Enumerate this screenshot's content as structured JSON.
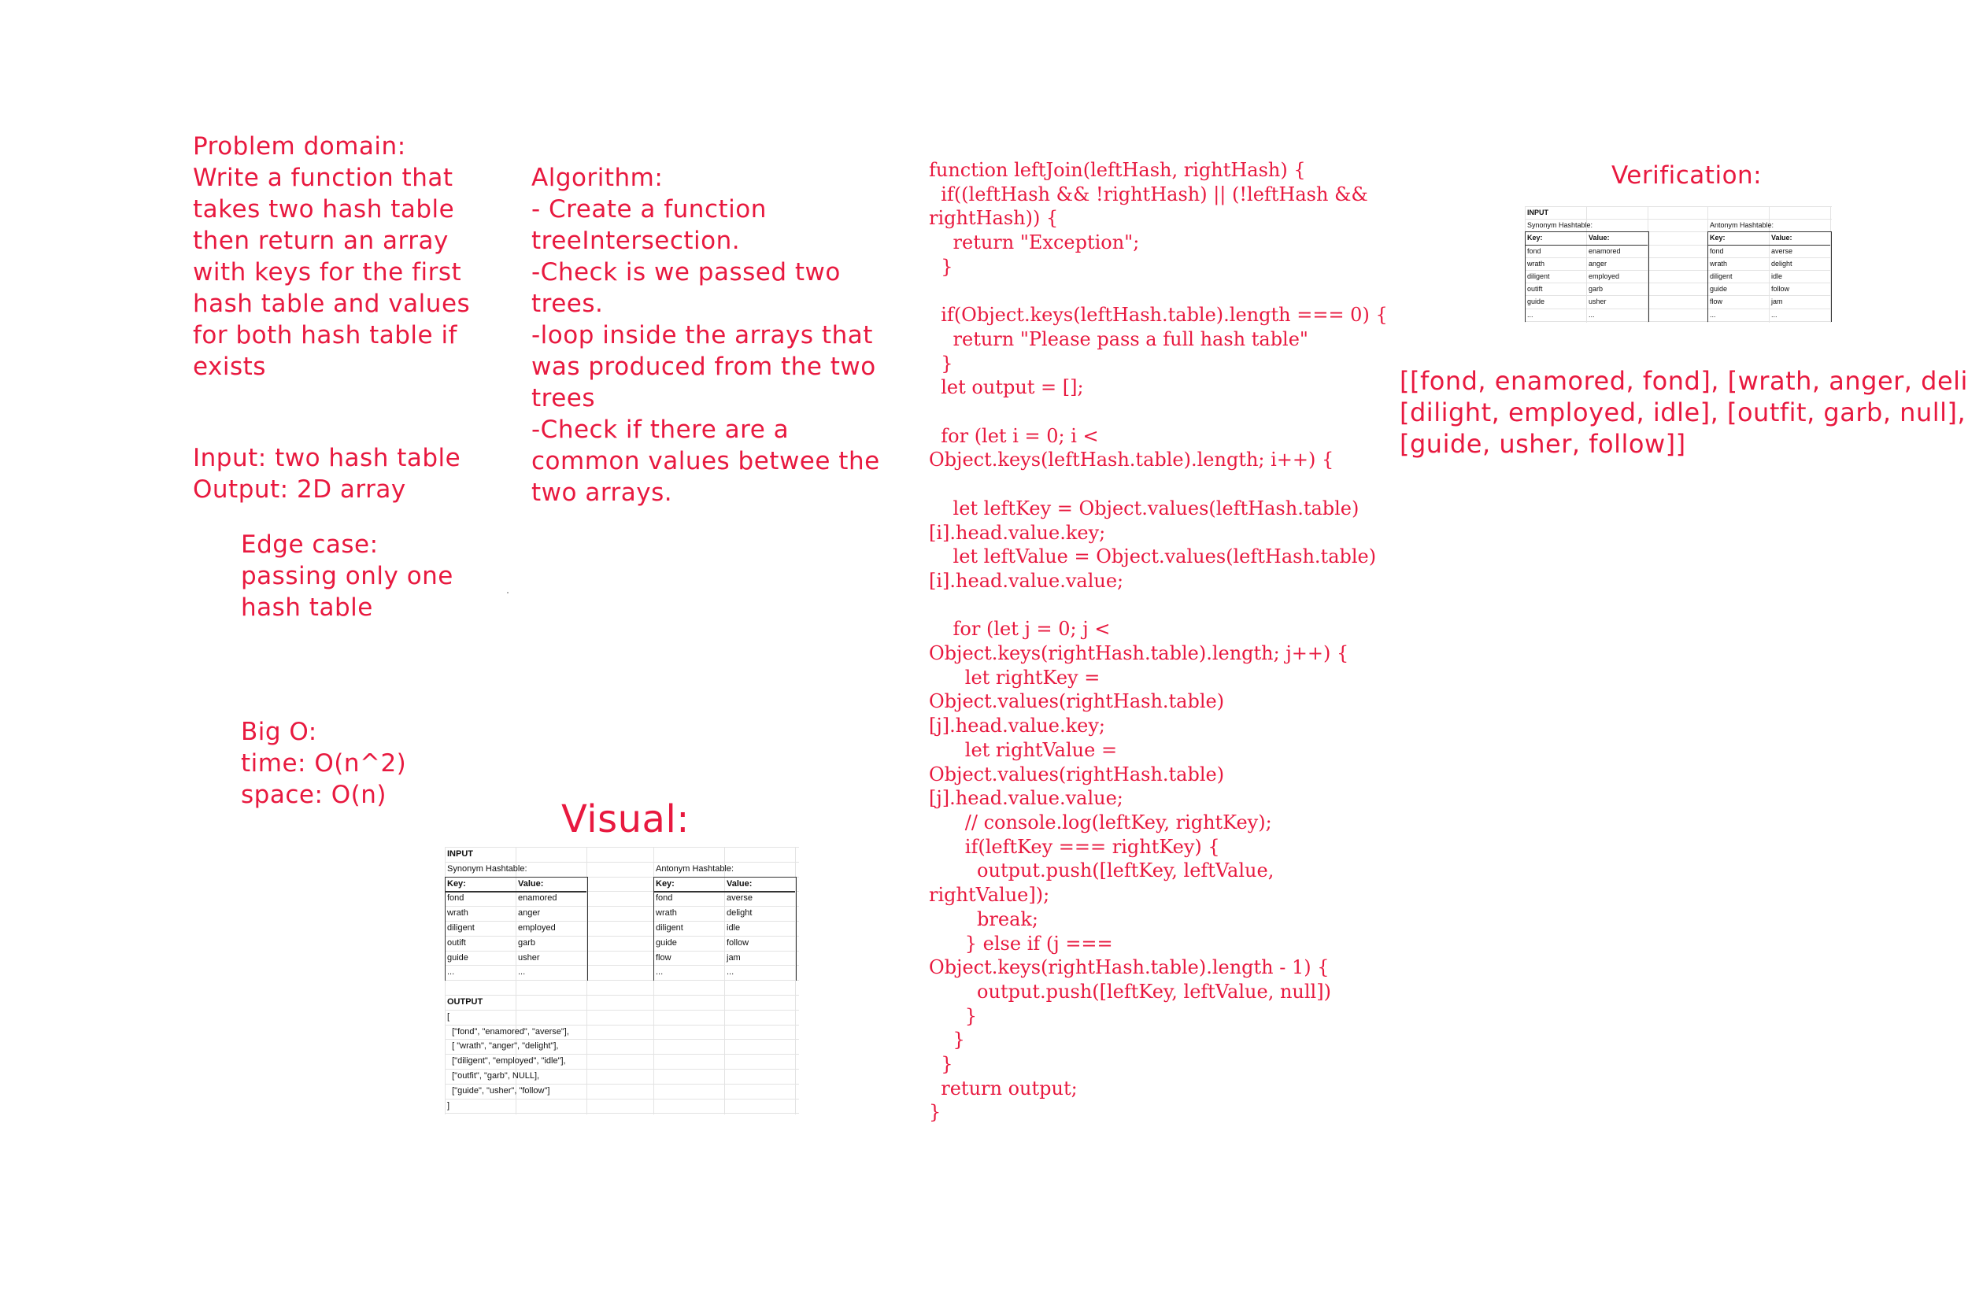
{
  "problem": {
    "text": "Problem domain:\nWrite a function that\ntakes two hash table\nthen return an array\nwith keys for the first\nhash table and values\nfor both hash table if\nexists"
  },
  "io": {
    "text": "Input: two hash table\nOutput: 2D array"
  },
  "edge_case": {
    "text": "Edge case:\npassing only one\nhash table"
  },
  "big_o": {
    "text": "Big O:\ntime: O(n^2)\nspace: O(n)"
  },
  "algorithm": {
    "text": "Algorithm:\n- Create a function\ntreeIntersection.\n-Check is we passed two\ntrees.\n-loop inside the arrays that\nwas produced from the two\ntrees\n-Check if there are a\ncommon values betwee the\ntwo arrays."
  },
  "visual": {
    "title": "Visual:",
    "sheet": {
      "input_label": "INPUT",
      "syn_label": "Synonym Hashtable:",
      "ant_label": "Antonym Hashtable:",
      "key_header": "Key:",
      "value_header": "Value:",
      "syn_rows": [
        [
          "fond",
          "enamored"
        ],
        [
          "wrath",
          "anger"
        ],
        [
          "diligent",
          "employed"
        ],
        [
          "outift",
          "garb"
        ],
        [
          "guide",
          "usher"
        ],
        [
          "...",
          "..."
        ]
      ],
      "ant_rows": [
        [
          "fond",
          "averse"
        ],
        [
          "wrath",
          "delight"
        ],
        [
          "diligent",
          "idle"
        ],
        [
          "guide",
          "follow"
        ],
        [
          "flow",
          "jam"
        ],
        [
          "...",
          "..."
        ]
      ],
      "output_label": "OUTPUT",
      "output_lines": [
        "[",
        "  [\"fond\", \"enamored\", \"averse\"],",
        "  [ \"wrath\", \"anger\", \"delight\"],",
        "  [\"diligent\", \"employed\", \"idle\"],",
        "  [\"outfit\", \"garb\", NULL],",
        "  [\"guide\", \"usher\", \"follow\"]",
        "]"
      ]
    }
  },
  "code": {
    "text": "function leftJoin(leftHash, rightHash) {\n  if((leftHash && !rightHash) || (!leftHash &&\nrightHash)) {\n    return \"Exception\";\n  }\n\n  if(Object.keys(leftHash.table).length === 0) {\n    return \"Please pass a full hash table\"\n  }\n  let output = [];\n\n  for (let i = 0; i <\nObject.keys(leftHash.table).length; i++) {\n\n    let leftKey = Object.values(leftHash.table)\n[i].head.value.key;\n    let leftValue = Object.values(leftHash.table)\n[i].head.value.value;\n\n    for (let j = 0; j <\nObject.keys(rightHash.table).length; j++) {\n      let rightKey =\nObject.values(rightHash.table)\n[j].head.value.key;\n      let rightValue =\nObject.values(rightHash.table)\n[j].head.value.value;\n      // console.log(leftKey, rightKey);\n      if(leftKey === rightKey) {\n        output.push([leftKey, leftValue,\nrightValue]);\n        break;\n      } else if (j ===\nObject.keys(rightHash.table).length - 1) {\n        output.push([leftKey, leftValue, null])\n      }\n    }\n  }\n  return output;\n}"
  },
  "verification": {
    "title": "Verification:",
    "output_text": "[[fond, enamored, fond], [wrath, anger, delight],\n[dilight, employed, idle], [outfit, garb, null],\n[guide, usher, follow]]"
  }
}
